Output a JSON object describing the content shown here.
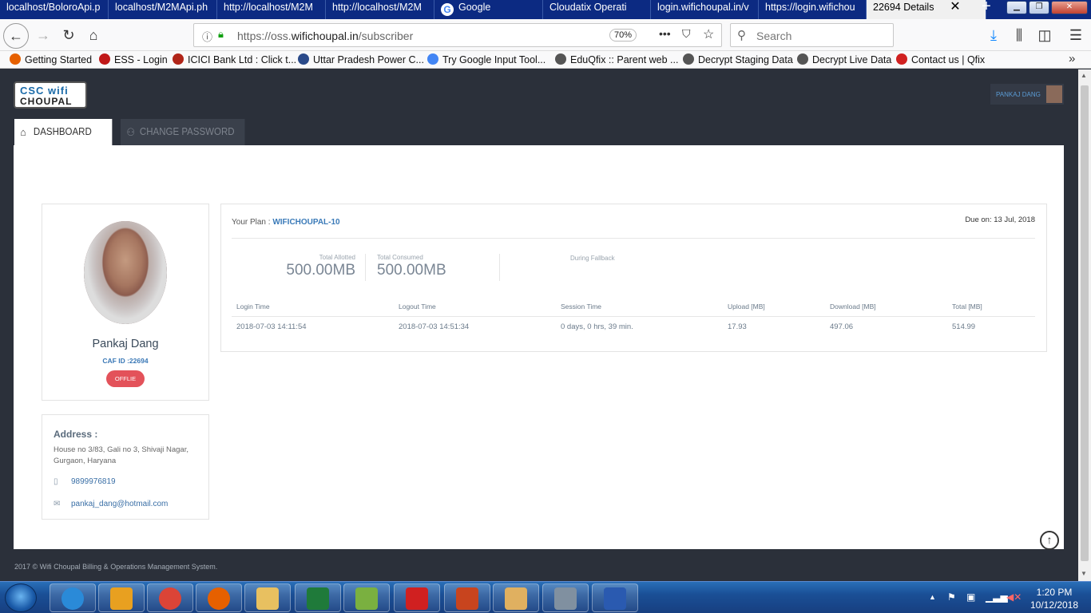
{
  "browser": {
    "tabs": [
      {
        "title": "localhost/BoloroApi.p",
        "active": false
      },
      {
        "title": "localhost/M2MApi.ph",
        "active": false
      },
      {
        "title": "http://localhost/M2M",
        "active": false
      },
      {
        "title": "http://localhost/M2M",
        "active": false
      },
      {
        "title": "Google",
        "active": false
      },
      {
        "title": "Cloudatix Operati",
        "active": false
      },
      {
        "title": "login.wifichoupal.in/v",
        "active": false
      },
      {
        "title": "https://login.wifichou",
        "active": false
      },
      {
        "title": "22694 Details",
        "active": true
      }
    ],
    "close_tab": "✕",
    "new_tab": "+",
    "url_prefix": "https://oss.",
    "url_domain": "wifichoupal.in",
    "url_path": "/subscriber",
    "zoom": "70%",
    "search_placeholder": "Search",
    "bookmarks": [
      {
        "label": "Getting Started",
        "color": "#e66000"
      },
      {
        "label": "ESS - Login",
        "color": "#c01818"
      },
      {
        "label": "ICICI Bank Ltd : Click t...",
        "color": "#b02418"
      },
      {
        "label": "Uttar Pradesh Power C...",
        "color": "#2a4a8a"
      },
      {
        "label": "Try Google Input Tool...",
        "color": "#4285f4"
      },
      {
        "label": "EduQfix :: Parent web ...",
        "color": "#555555"
      },
      {
        "label": "Decrypt Staging Data",
        "color": "#555555"
      },
      {
        "label": "Decrypt Live Data",
        "color": "#555555"
      },
      {
        "label": "Contact us | Qfix",
        "color": "#d02020"
      }
    ]
  },
  "app": {
    "logo_line1": "CSC wifi",
    "logo_line2": "CHOUPAL",
    "user_name": "PANKAJ DANG",
    "tabs": [
      {
        "label": "Dashboard",
        "icon": "⌂"
      },
      {
        "label": "Change Password",
        "icon": "⚇"
      }
    ],
    "profile": {
      "name": "Pankaj Dang",
      "caf_id": "CAF ID :22694",
      "status": "OFFLIE"
    },
    "address": {
      "heading": "Address :",
      "text": "House no 3/83, Gali no 3, Shivaji Nagar, Gurgaon, Haryana",
      "phone": "9899976819",
      "email": "pankaj_dang@hotmail.com"
    },
    "plan": {
      "label": "Your Plan : ",
      "name": "WIFICHOUPAL-10",
      "due": "Due on: 13 Jul, 2018",
      "total_allotted_label": "Total Allotted",
      "total_allotted": "500.00MB",
      "total_consumed_label": "Total Consumed",
      "total_consumed": "500.00MB",
      "fallback_label": "During Fallback"
    },
    "sessions": {
      "columns": [
        "Login Time",
        "Logout Time",
        "Session Time",
        "Upload [MB]",
        "Download [MB]",
        "Total [MB]"
      ],
      "rows": [
        [
          "2018-07-03 14:11:54",
          "2018-07-03 14:51:34",
          "0 days, 0 hrs, 39 min.",
          "17.93",
          "497.06",
          "514.99"
        ]
      ]
    },
    "footer": "2017 © Wifi Choupal Billing & Operations Management System."
  },
  "taskbar": {
    "time": "1:20 PM",
    "date": "10/12/2018",
    "apps": [
      {
        "name": "internet-explorer",
        "color": "#2a8ad8"
      },
      {
        "name": "outlook",
        "color": "#e8a020"
      },
      {
        "name": "chrome",
        "color": "#db4437"
      },
      {
        "name": "firefox",
        "color": "#e66000"
      },
      {
        "name": "file-explorer",
        "color": "#e8c060"
      },
      {
        "name": "excel",
        "color": "#1f7a3a"
      },
      {
        "name": "notepad-plus",
        "color": "#7ab040"
      },
      {
        "name": "acrobat",
        "color": "#d02020"
      },
      {
        "name": "powerpoint",
        "color": "#c8441e"
      },
      {
        "name": "paint",
        "color": "#e0b060"
      },
      {
        "name": "vpn-client",
        "color": "#8090a0"
      },
      {
        "name": "word",
        "color": "#2a5ab0"
      }
    ]
  }
}
